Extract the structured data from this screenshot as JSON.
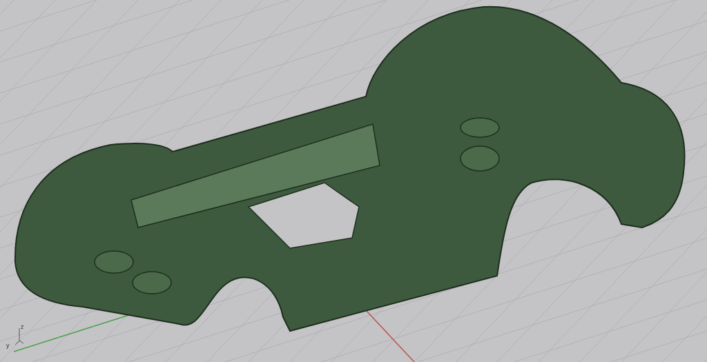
{
  "viewport": {
    "axis_gizmo": {
      "labels": [
        {
          "kind": "z",
          "text": "z"
        },
        {
          "kind": "y",
          "text": "y"
        }
      ]
    }
  }
}
